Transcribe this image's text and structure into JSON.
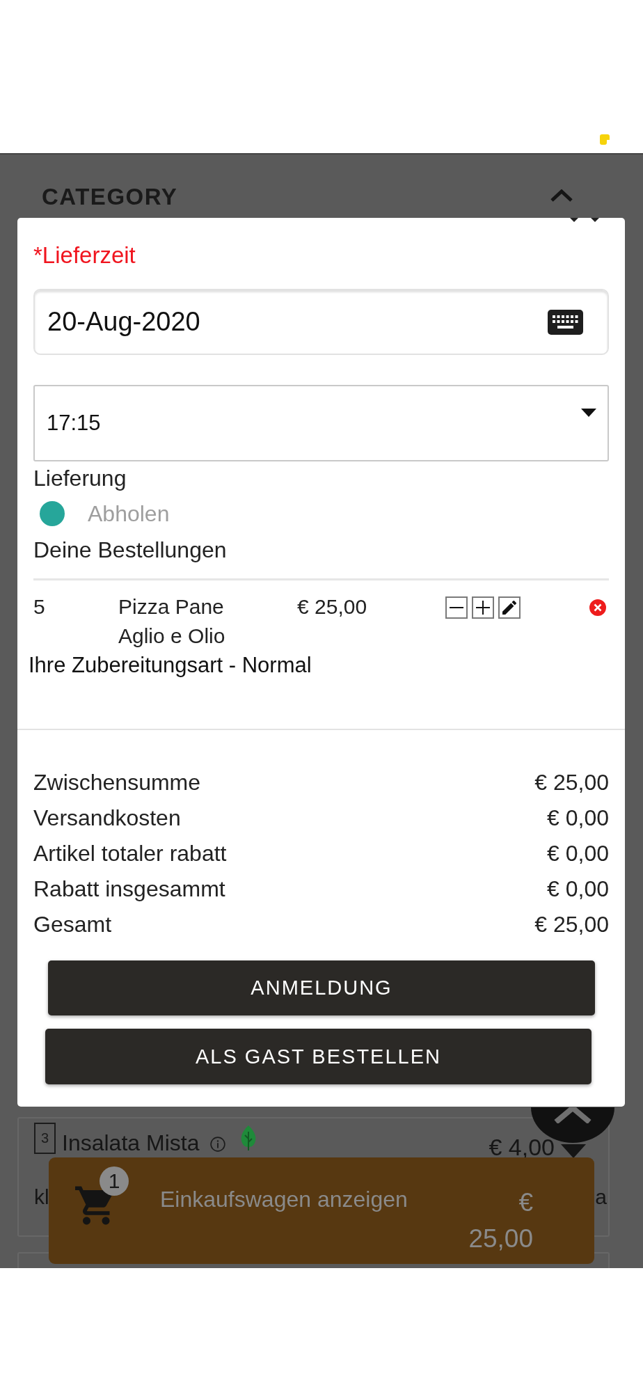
{
  "category": {
    "title": "CATEGORY",
    "expanded": true
  },
  "modal": {
    "delivery_time_label": "*Lieferzeit",
    "date_field": {
      "value": "20-Aug-2020"
    },
    "time_select": {
      "value": "17:15"
    },
    "delivery_mode_label": "Lieferung",
    "delivery_options": [
      {
        "label": "Abholen",
        "selected": true
      }
    ],
    "orders_heading": "Deine Bestellungen",
    "orders": [
      {
        "quantity": "5",
        "name": "Pizza Pane Aglio e Olio",
        "price": "€ 25,00",
        "preparation": "Ihre Zubereitungsart - Normal"
      }
    ],
    "totals": [
      {
        "label": "Zwischensumme",
        "value": "€ 25,00"
      },
      {
        "label": "Versandkosten",
        "value": "€ 0,00"
      },
      {
        "label": "Artikel totaler rabatt",
        "value": "€ 0,00"
      },
      {
        "label": "Rabatt insgesammt",
        "value": "€ 0,00"
      },
      {
        "label": "Gesamt",
        "value": "€ 25,00"
      }
    ],
    "buttons": [
      {
        "label": "ANMELDUNG"
      },
      {
        "label": "ALS GAST BESTELLEN"
      }
    ]
  },
  "menu_item": {
    "number": "3",
    "name": "Insalata Mista",
    "price": "€ 4,00",
    "description_parts": [
      "kl",
      "a"
    ]
  },
  "cart_bar": {
    "count": "1",
    "label": "Einkaufswagen anzeigen",
    "price": "€ 25,00"
  }
}
